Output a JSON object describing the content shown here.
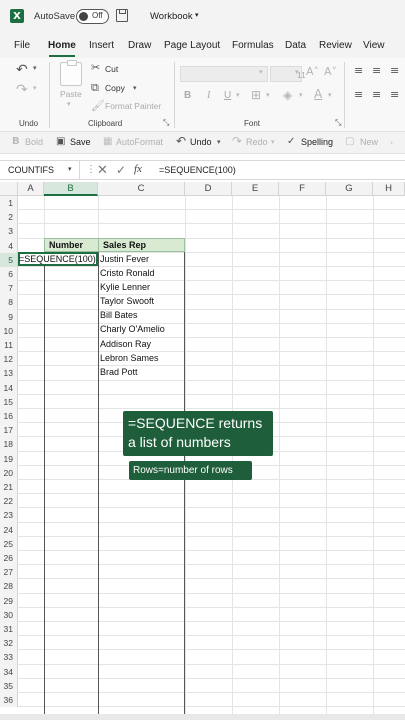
{
  "titlebar": {
    "autosave_label": "AutoSave",
    "autosave_state": "Off",
    "workbook_name": "Workbook",
    "caret": "▾"
  },
  "tabs": [
    "File",
    "Home",
    "Insert",
    "Draw",
    "Page Layout",
    "Formulas",
    "Data",
    "Review",
    "View"
  ],
  "active_tab": "Home",
  "ribbon": {
    "undo_label": "Undo",
    "paste_label": "Paste",
    "cut_label": "Cut",
    "copy_label": "Copy",
    "format_painter_label": "Format Painter",
    "clipboard_label": "Clipboard",
    "font_label": "Font",
    "font_size_value": "11",
    "bold": "B",
    "italic": "I",
    "underline": "U"
  },
  "quick_toolbar": {
    "bold": "Bold",
    "save": "Save",
    "autoformat": "AutoFormat",
    "undo": "Undo",
    "redo": "Redo",
    "spelling": "Spelling",
    "new": "New"
  },
  "formula_bar": {
    "name_box": "COUNTIFS",
    "formula": "=SEQUENCE(100)"
  },
  "grid": {
    "columns": [
      "A",
      "B",
      "C",
      "D",
      "E",
      "F",
      "G",
      "H"
    ],
    "rows": [
      "1",
      "2",
      "3",
      "4",
      "5",
      "6",
      "7",
      "8",
      "9",
      "10",
      "11",
      "12",
      "13",
      "14",
      "15",
      "16",
      "17",
      "18",
      "19",
      "20",
      "21",
      "22",
      "23",
      "24",
      "25",
      "26",
      "27",
      "28",
      "29",
      "30",
      "31",
      "32",
      "33",
      "34",
      "35",
      "36"
    ],
    "selected_column": "B",
    "selected_row": "5",
    "header_number": "Number",
    "header_sales_rep": "Sales Rep",
    "edit_value": "=SEQUENCE(100)",
    "sales_reps": [
      "Justin Fever",
      "Cristo Ronald",
      "Kylie Lenner",
      "Taylor Swooft",
      "Bill Bates",
      "Charly O'Amelio",
      "Addison Ray",
      "Lebron Sames",
      "Brad Pott"
    ]
  },
  "callouts": {
    "main_line1": "=SEQUENCE returns",
    "main_line2": "a list of numbers",
    "sub": "Rows=number of rows"
  },
  "colors": {
    "excel_green": "#1d6f42",
    "callout_bg": "#1f5e3b",
    "header_fill": "#d9ead3"
  }
}
